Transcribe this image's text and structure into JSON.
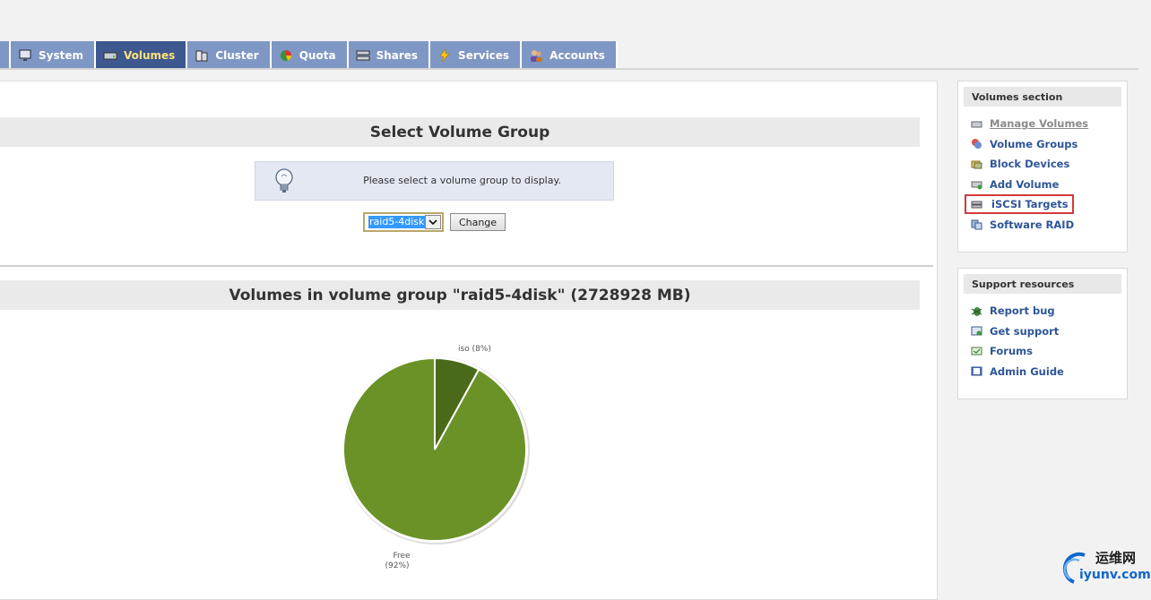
{
  "nav": {
    "tabs": [
      {
        "label": "System",
        "icon": "monitor-icon",
        "active": false
      },
      {
        "label": "Volumes",
        "icon": "drive-icon",
        "active": true
      },
      {
        "label": "Cluster",
        "icon": "cluster-icon",
        "active": false
      },
      {
        "label": "Quota",
        "icon": "pie-icon",
        "active": false
      },
      {
        "label": "Shares",
        "icon": "server-icon",
        "active": false
      },
      {
        "label": "Services",
        "icon": "lightning-icon",
        "active": false
      },
      {
        "label": "Accounts",
        "icon": "users-icon",
        "active": false
      }
    ],
    "colors": {
      "tab": "#7f97c4",
      "active_tab": "#3d578f",
      "active_text": "#ffe37a"
    }
  },
  "select_section": {
    "title": "Select Volume Group",
    "info_message": "Please select a volume group to display.",
    "selected_group": "raid5-4disk",
    "change_label": "Change"
  },
  "volumes_section": {
    "title": "Volumes in volume group \"raid5-4disk\" (2728928 MB)"
  },
  "chart_data": {
    "type": "pie",
    "slices": [
      {
        "label": "iso",
        "percent": 8,
        "display": "iso (8%)",
        "color": "#4a6a1a"
      },
      {
        "label": "Free",
        "percent": 92,
        "display_name": "Free",
        "display_pct": "(92%)",
        "color": "#6a9226"
      }
    ]
  },
  "sidebar": {
    "volumes": {
      "title": "Volumes section",
      "items": [
        {
          "label": "Manage Volumes",
          "icon": "drive-icon"
        },
        {
          "label": "Volume Groups",
          "icon": "volume-groups-icon"
        },
        {
          "label": "Block Devices",
          "icon": "block-devices-icon"
        },
        {
          "label": "Add Volume",
          "icon": "add-volume-icon"
        },
        {
          "label": "iSCSI Targets",
          "icon": "iscsi-icon"
        },
        {
          "label": "Software RAID",
          "icon": "raid-icon"
        }
      ]
    },
    "support": {
      "title": "Support resources",
      "items": [
        {
          "label": "Report bug",
          "icon": "bug-icon"
        },
        {
          "label": "Get support",
          "icon": "support-icon"
        },
        {
          "label": "Forums",
          "icon": "forum-icon"
        },
        {
          "label": "Admin Guide",
          "icon": "book-icon"
        }
      ]
    }
  },
  "watermark": {
    "cn": "运维网",
    "en": "iyunv.com"
  }
}
